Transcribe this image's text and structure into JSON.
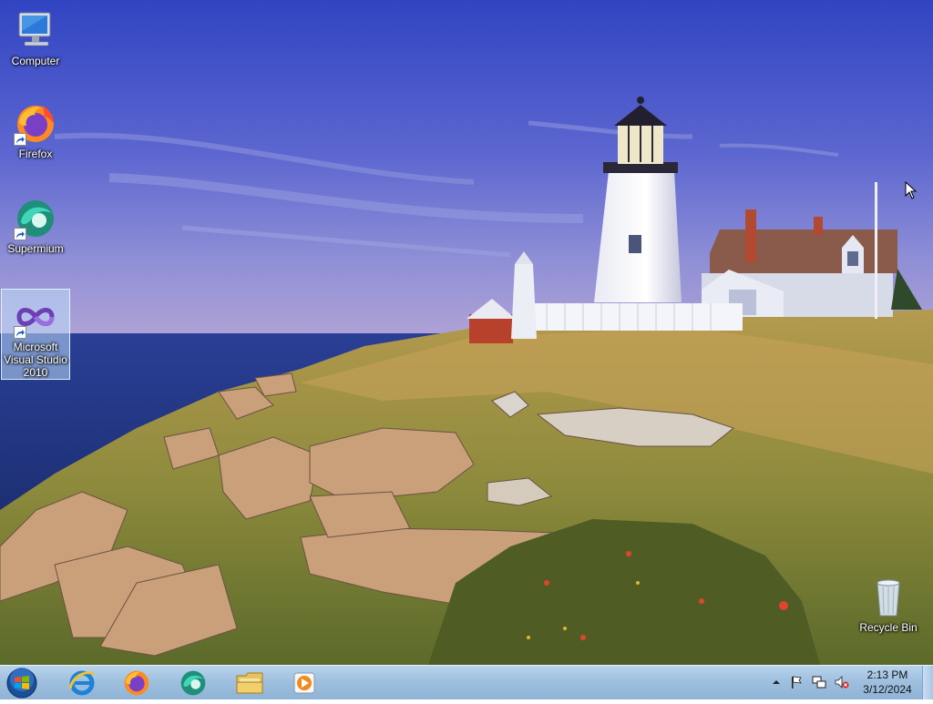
{
  "desktop": {
    "icons": [
      {
        "label": "Computer"
      },
      {
        "label": "Firefox"
      },
      {
        "label": "Supermium"
      },
      {
        "label": "Microsoft Visual Studio 2010"
      },
      {
        "label": "Recycle Bin"
      }
    ]
  },
  "taskbar": {
    "pinned": [
      "Internet Explorer",
      "Firefox",
      "Supermium",
      "Windows Explorer",
      "Windows Media Player"
    ],
    "clock": {
      "time": "2:13 PM",
      "date": "3/12/2024"
    }
  },
  "colors": {
    "taskbar": "#9fc0df",
    "sky_top": "#3a4fc8",
    "sea": "#1f3a8a",
    "selection": "#bedcfa"
  }
}
